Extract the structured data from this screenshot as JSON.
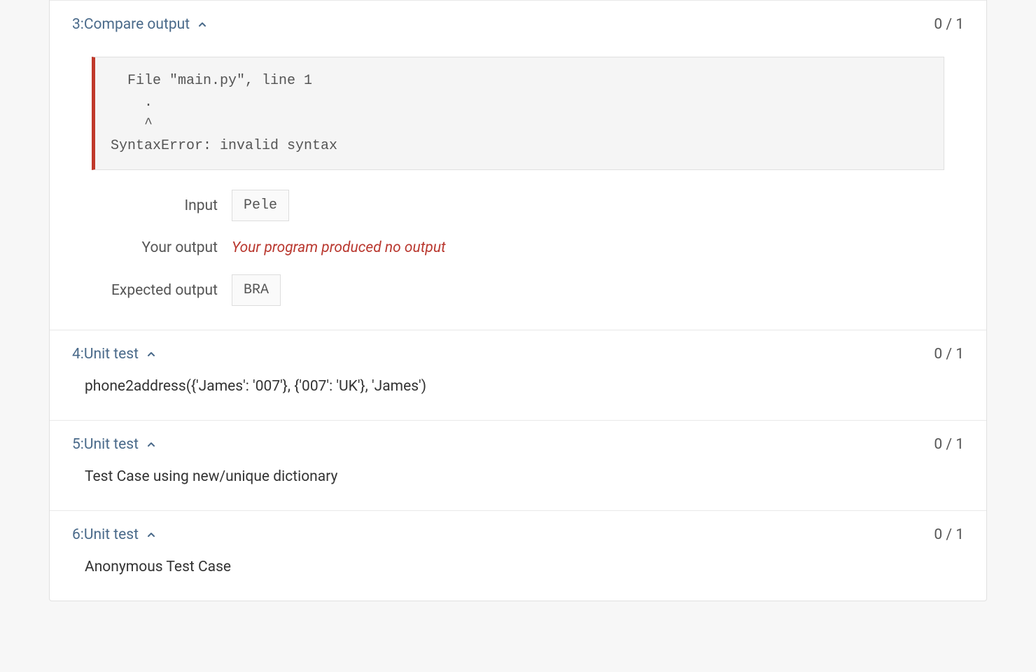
{
  "sections": [
    {
      "id": "3",
      "title": "3:Compare output",
      "score": "0 / 1",
      "error_text": "  File \"main.py\", line 1\n    .\n    ^\nSyntaxError: invalid syntax",
      "input_label": "Input",
      "input_value": "Pele",
      "your_output_label": "Your output",
      "your_output_value": "Your program produced no output",
      "expected_label": "Expected output",
      "expected_value": "BRA"
    },
    {
      "id": "4",
      "title": "4:Unit test",
      "score": "0 / 1",
      "desc": "phone2address({'James': '007'}, {'007': 'UK'}, 'James')"
    },
    {
      "id": "5",
      "title": "5:Unit test",
      "score": "0 / 1",
      "desc": "Test Case using new/unique dictionary"
    },
    {
      "id": "6",
      "title": "6:Unit test",
      "score": "0 / 1",
      "desc": "Anonymous Test Case"
    }
  ]
}
